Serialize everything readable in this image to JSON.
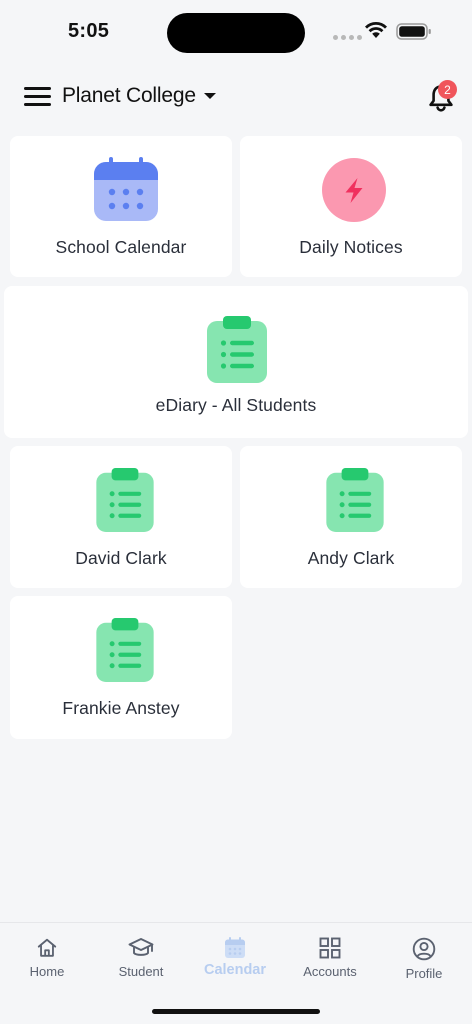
{
  "status_bar": {
    "time": "5:05"
  },
  "header": {
    "school_name": "Planet College",
    "notification_count": "2"
  },
  "tiles": [
    {
      "label": "School Calendar",
      "icon": "calendar-icon"
    },
    {
      "label": "Daily Notices",
      "icon": "lightning-icon"
    },
    {
      "label": "eDiary - All Students",
      "icon": "clipboard-list-icon"
    },
    {
      "label": "David Clark",
      "icon": "clipboard-list-icon"
    },
    {
      "label": "Andy Clark",
      "icon": "clipboard-list-icon"
    },
    {
      "label": "Frankie Anstey",
      "icon": "clipboard-list-icon"
    }
  ],
  "bottom_nav": {
    "active": "Calendar",
    "items": [
      {
        "label": "Home",
        "icon": "home-icon"
      },
      {
        "label": "Student",
        "icon": "graduation-cap-icon"
      },
      {
        "label": "Calendar",
        "icon": "calendar-icon"
      },
      {
        "label": "Accounts",
        "icon": "grid-icon"
      },
      {
        "label": "Profile",
        "icon": "user-circle-icon"
      }
    ]
  },
  "colors": {
    "background": "#f5f6f8",
    "calendar_blue": "#5b7ff0",
    "calendar_light": "#a9b9f7",
    "notice_pink": "#fb98b0",
    "notice_red": "#f0305e",
    "diary_green": "#86e5b0",
    "diary_dark_green": "#26c96f",
    "nav_active": "#b7cdf0",
    "badge_red": "#f0555b"
  }
}
